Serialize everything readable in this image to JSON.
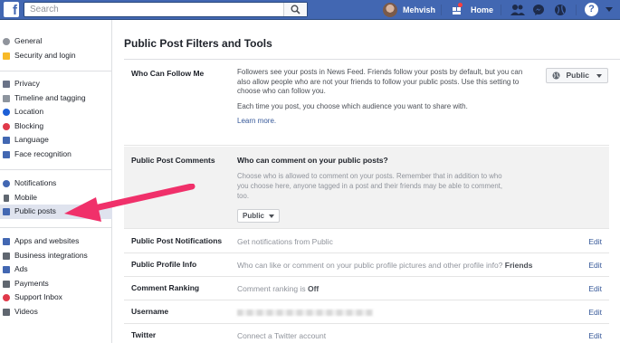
{
  "topbar": {
    "search_placeholder": "Search",
    "user_name": "Mehvish",
    "home_label": "Home",
    "help_glyph": "?"
  },
  "sidebar": {
    "groups": [
      [
        {
          "label": "General",
          "icon": "gear-icon",
          "color": "#90949c"
        },
        {
          "label": "Security and login",
          "icon": "shield-icon",
          "color": "#f7b928"
        }
      ],
      [
        {
          "label": "Privacy",
          "icon": "lock-icon",
          "color": "#6a7388"
        },
        {
          "label": "Timeline and tagging",
          "icon": "timeline-icon",
          "color": "#8d949e"
        },
        {
          "label": "Location",
          "icon": "location-icon",
          "color": "#1c5fd6"
        },
        {
          "label": "Blocking",
          "icon": "blocking-icon",
          "color": "#e0394a"
        },
        {
          "label": "Language",
          "icon": "language-icon",
          "color": "#4267b2"
        },
        {
          "label": "Face recognition",
          "icon": "face-icon",
          "color": "#4267b2"
        }
      ],
      [
        {
          "label": "Notifications",
          "icon": "globe-icon",
          "color": "#4267b2"
        },
        {
          "label": "Mobile",
          "icon": "mobile-icon",
          "color": "#606770"
        },
        {
          "label": "Public posts",
          "icon": "rss-icon",
          "color": "#4267b2",
          "active": true
        }
      ],
      [
        {
          "label": "Apps and websites",
          "icon": "apps-icon",
          "color": "#4267b2"
        },
        {
          "label": "Business integrations",
          "icon": "business-icon",
          "color": "#606770"
        },
        {
          "label": "Ads",
          "icon": "ads-icon",
          "color": "#4267b2"
        },
        {
          "label": "Payments",
          "icon": "payments-icon",
          "color": "#606770"
        },
        {
          "label": "Support Inbox",
          "icon": "support-icon",
          "color": "#e0394a"
        },
        {
          "label": "Videos",
          "icon": "videos-icon",
          "color": "#606770"
        }
      ]
    ]
  },
  "main": {
    "title": "Public Post Filters and Tools",
    "follow": {
      "label": "Who Can Follow Me",
      "p1": "Followers see your posts in News Feed. Friends follow your posts by default, but you can also allow people who are not your friends to follow your public posts. Use this setting to choose who can follow you.",
      "p2": "Each time you post, you choose which audience you want to share with.",
      "learn_more": "Learn more.",
      "audience": "Public"
    },
    "comments": {
      "label": "Public Post Comments",
      "question": "Who can comment on your public posts?",
      "desc": "Choose who is allowed to comment on your posts. Remember that in addition to who you choose here, anyone tagged in a post and their friends may be able to comment, too.",
      "audience": "Public"
    },
    "rows": [
      {
        "label": "Public Post Notifications",
        "desc": "Get notifications from Public",
        "value": "",
        "edit": "Edit"
      },
      {
        "label": "Public Profile Info",
        "desc": "Who can like or comment on your public profile pictures and other profile info?",
        "value": "Friends",
        "edit": "Edit"
      },
      {
        "label": "Comment Ranking",
        "desc": "Comment ranking is",
        "value": "Off",
        "edit": "Edit"
      },
      {
        "label": "Username",
        "desc": "",
        "value": "",
        "edit": "Edit"
      },
      {
        "label": "Twitter",
        "desc": "Connect a Twitter account",
        "value": "",
        "edit": "Edit"
      }
    ]
  },
  "colors": {
    "brand": "#4267b2",
    "link": "#365899",
    "annotation_arrow": "#f0306a"
  }
}
